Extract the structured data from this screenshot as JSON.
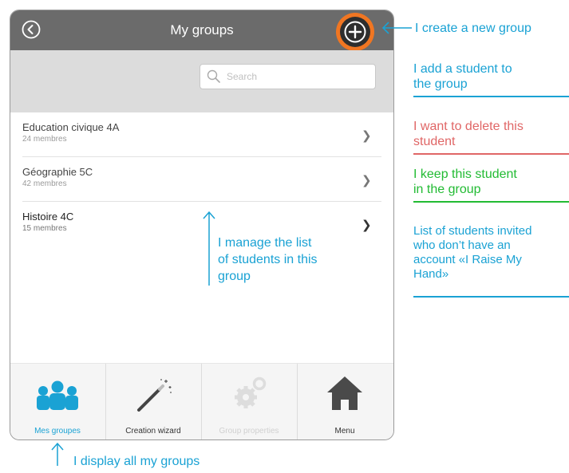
{
  "colors": {
    "cyan": "#1aa2d4",
    "red": "#e06666",
    "green": "#22bb33",
    "orange": "#f07622",
    "navbar": "#6b6b6b"
  },
  "navbar": {
    "title": "My groups",
    "back_icon": "chevron-left-icon",
    "add_icon": "plus-icon"
  },
  "search": {
    "placeholder": "Search"
  },
  "groups": [
    {
      "name": "Education civique 4A",
      "members": "24 membres"
    },
    {
      "name": "Géographie 5C",
      "members": "42 membres"
    },
    {
      "name": "Histoire 4C",
      "members": "15 membres"
    }
  ],
  "tabs": [
    {
      "label": "Mes groupes",
      "icon": "group-icon"
    },
    {
      "label": "Creation wizard",
      "icon": "magic-wand-icon"
    },
    {
      "label": "Group properties",
      "icon": "gears-icon"
    },
    {
      "label": "Menu",
      "icon": "home-icon"
    }
  ],
  "annotations": {
    "create_group": "I create a new group",
    "add_student_1": "I add a student to",
    "add_student_2": "the group",
    "delete_1": "I want to delete this",
    "delete_2": "student",
    "keep_1": "I keep this  student",
    "keep_2": "in the group",
    "invited_1": "List of students invited",
    "invited_2": "who don’t have an",
    "invited_3": "account «I Raise My",
    "invited_4": "Hand»",
    "manage_1": "I manage the list",
    "manage_2": "of students in this",
    "manage_3": "group",
    "display_all": "I display all my groups"
  }
}
